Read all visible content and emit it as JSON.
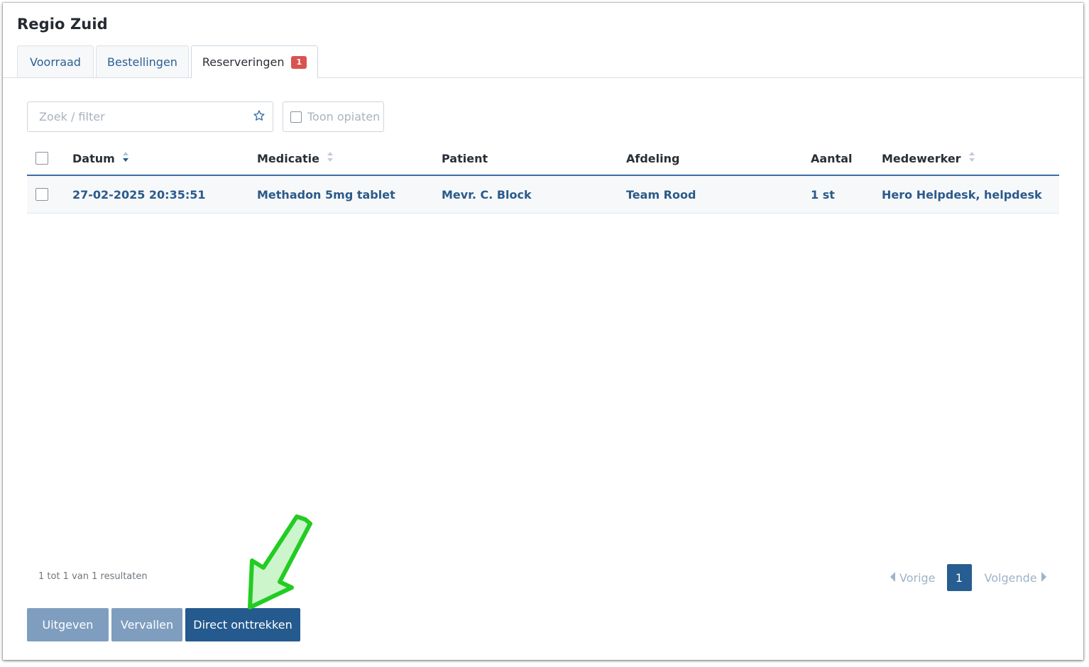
{
  "page": {
    "title": "Regio Zuid"
  },
  "tabs": [
    {
      "label": "Voorraad"
    },
    {
      "label": "Bestellingen"
    },
    {
      "label": "Reserveringen",
      "badge": "1"
    }
  ],
  "filters": {
    "search_placeholder": "Zoek / filter",
    "toggle_label": "Toon opiaten"
  },
  "table": {
    "columns": [
      "Datum",
      "Medicatie",
      "Patient",
      "Afdeling",
      "Aantal",
      "Medewerker"
    ],
    "rows": [
      [
        "27-02-2025 20:35:51",
        "Methadon 5mg tablet",
        "Mevr. C. Block",
        "Team Rood",
        "1 st",
        "Hero Helpdesk, helpdesk"
      ]
    ]
  },
  "footer": {
    "result_count": "1 tot 1 van 1 resultaten",
    "prev_label": "Vorige",
    "next_label": "Volgende",
    "current_page": "1"
  },
  "actions": {
    "issue_label": "Uitgeven",
    "expire_label": "Vervallen",
    "withdraw_label": "Direct onttrekken"
  },
  "colors": {
    "primary": "#245a8e",
    "primary_light": "#7f9ebf",
    "badge": "#d9534f",
    "link": "#2b5a8a",
    "annotation_arrow": "#22cc22"
  },
  "icons": {
    "favorite": "star-icon",
    "sort": "sort-icon",
    "prev": "caret-left-icon",
    "next": "caret-right-icon"
  }
}
